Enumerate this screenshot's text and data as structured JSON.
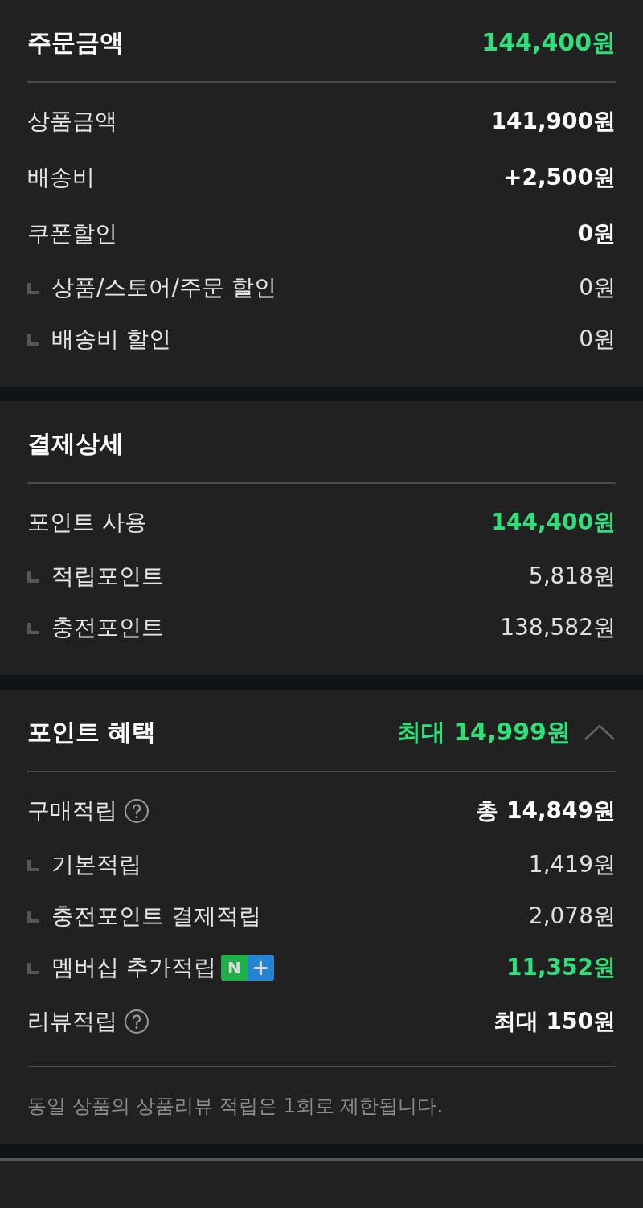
{
  "sections": [
    {
      "title": "주문금액",
      "header_value": "144,400원",
      "rows": [
        {
          "kind": "main",
          "label": "상품금액",
          "value": "141,900원",
          "highlight": false,
          "help": false
        },
        {
          "kind": "main",
          "label": "배송비",
          "value": "+2,500원",
          "highlight": false,
          "help": false
        },
        {
          "kind": "main",
          "label": "쿠폰할인",
          "value": "0원",
          "highlight": false,
          "help": false
        },
        {
          "kind": "sub",
          "label": "상품/스토어/주문 할인",
          "value": "0원",
          "highlight": false
        },
        {
          "kind": "sub",
          "label": "배송비 할인",
          "value": "0원",
          "highlight": false
        }
      ]
    },
    {
      "title": "결제상세",
      "rows": [
        {
          "kind": "main",
          "label": "포인트 사용",
          "value": "144,400원",
          "highlight": true,
          "help": false
        },
        {
          "kind": "sub",
          "label": "적립포인트",
          "value": "5,818원",
          "highlight": false
        },
        {
          "kind": "sub",
          "label": "충전포인트",
          "value": "138,582원",
          "highlight": false
        }
      ]
    },
    {
      "title": "포인트 혜택",
      "header_value": "최대 14,999원",
      "expanded": true,
      "rows": [
        {
          "kind": "main",
          "label": "구매적립",
          "value": "총 14,849원",
          "highlight": false,
          "help": true
        },
        {
          "kind": "sub",
          "label": "기본적립",
          "value": "1,419원",
          "highlight": false
        },
        {
          "kind": "sub",
          "label": "충전포인트 결제적립",
          "value": "2,078원",
          "highlight": false
        },
        {
          "kind": "sub",
          "label": "멤버십 추가적립",
          "value": "11,352원",
          "highlight": true,
          "badge": [
            "N",
            "+"
          ]
        },
        {
          "kind": "main",
          "label": "리뷰적립",
          "value": "최대 150원",
          "highlight": false,
          "help": true
        }
      ],
      "note": "동일 상품의 상품리뷰 적립은 1회로 제한됩니다."
    }
  ]
}
